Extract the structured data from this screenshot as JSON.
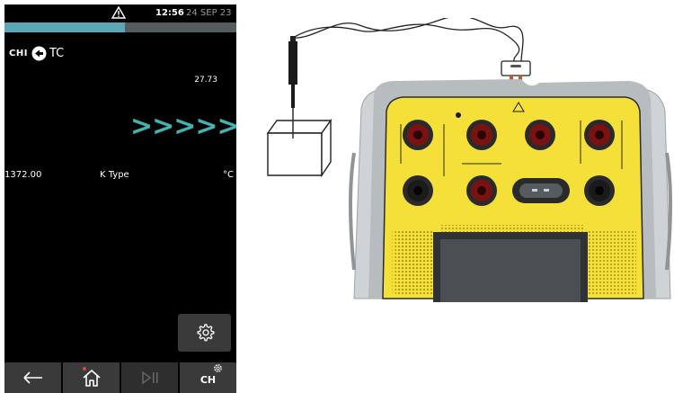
{
  "status_bar": {
    "time": "12:56",
    "date": "24 SEP 23",
    "warning_icon": "warning-triangle-icon",
    "progress": 0.52
  },
  "channel": {
    "label": "CHI",
    "direction_icon": "arrow-left-circle-icon",
    "type": "TC"
  },
  "readings": {
    "input_value": "27.73",
    "arrows": ">>>>>",
    "range_value": "1372.00",
    "sensor_type": "K Type",
    "unit": "°C"
  },
  "nav": {
    "back_icon": "arrow-left-icon",
    "home_icon": "home-icon",
    "play_pause_icon": "play-pause-icon",
    "channel_menu_label": "CH"
  },
  "colors": {
    "accent": "#41b4b2",
    "progress": "#5aa8b4",
    "device_yellow": "#f5e03a"
  }
}
